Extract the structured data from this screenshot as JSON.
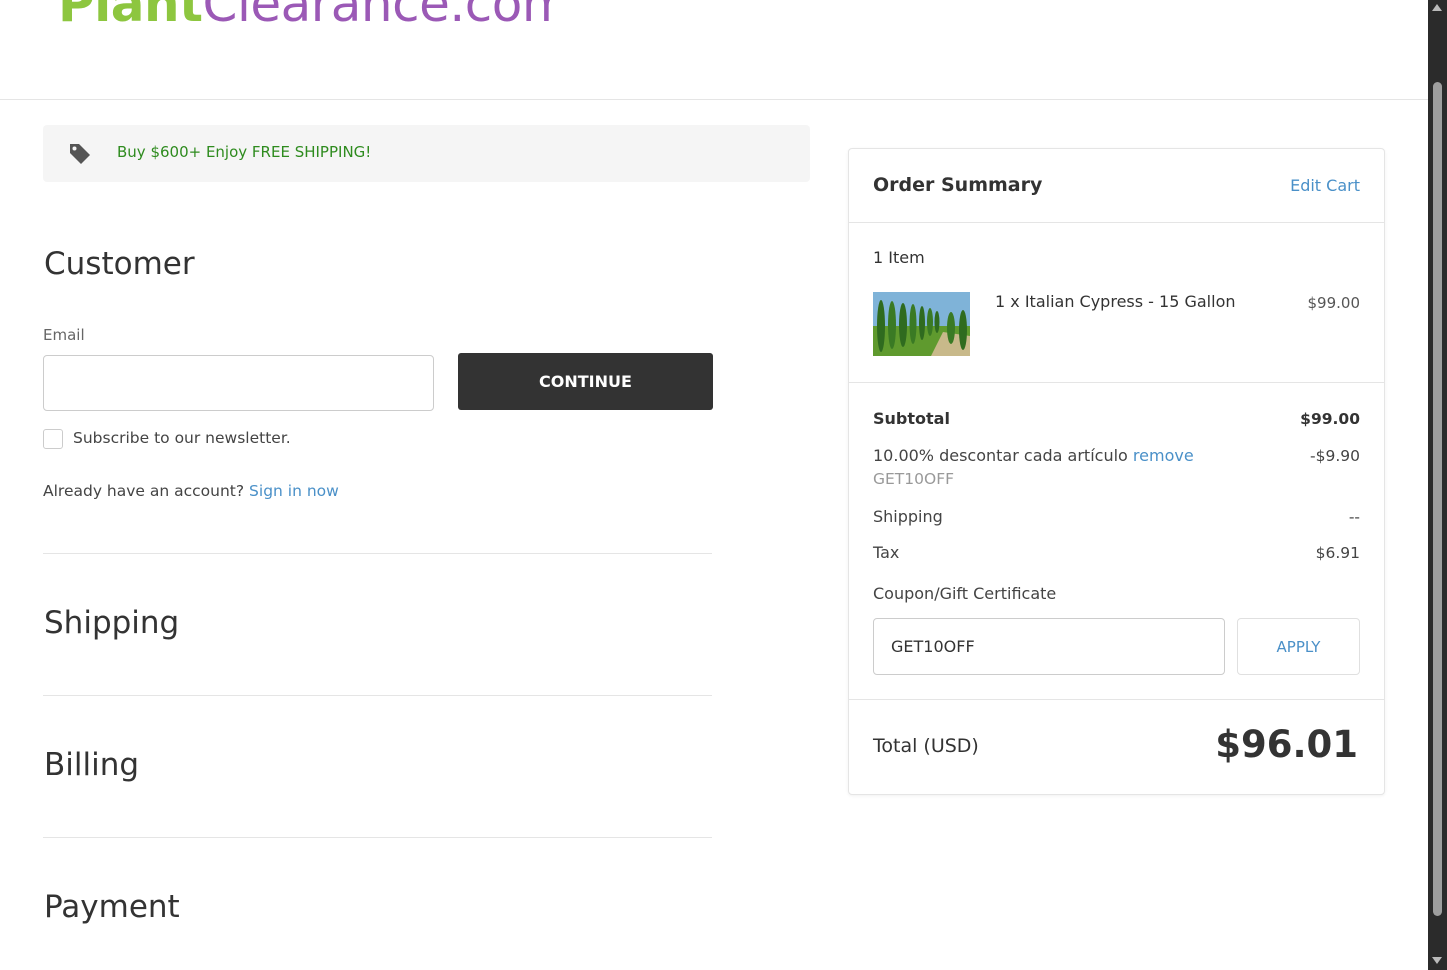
{
  "header": {
    "logo_part1": "Plant",
    "logo_part2": "Clearance.com"
  },
  "promo": {
    "icon": "tag-icon",
    "text": "Buy $600+ Enjoy FREE SHIPPING!"
  },
  "customer": {
    "title": "Customer",
    "email_label": "Email",
    "email_value": "",
    "continue_label": "CONTINUE",
    "newsletter_label": "Subscribe to our newsletter.",
    "newsletter_checked": false,
    "already_text": "Already have an account?",
    "sign_in_label": "Sign in now"
  },
  "sections": {
    "shipping": "Shipping",
    "billing": "Billing",
    "payment": "Payment"
  },
  "summary": {
    "title": "Order Summary",
    "edit_cart": "Edit Cart",
    "item_count": "1 Item",
    "items": [
      {
        "name": "1 x Italian Cypress - 15 Gallon",
        "price": "$99.00"
      }
    ],
    "subtotal_label": "Subtotal",
    "subtotal_value": "$99.00",
    "discount_label": "10.00% descontar cada artículo",
    "discount_remove": "remove",
    "discount_code": "GET10OFF",
    "discount_value": "-$9.90",
    "shipping_label": "Shipping",
    "shipping_value": "--",
    "tax_label": "Tax",
    "tax_value": "$6.91",
    "coupon_label": "Coupon/Gift Certificate",
    "coupon_value": "GET10OFF",
    "apply_label": "APPLY",
    "total_label": "Total (USD)",
    "total_value": "$96.01"
  },
  "colors": {
    "promo_text": "#2e8b1e",
    "link": "#4a90c8",
    "button_dark": "#333333",
    "logo_green": "#8dc63f",
    "logo_purple": "#9b59b6"
  }
}
